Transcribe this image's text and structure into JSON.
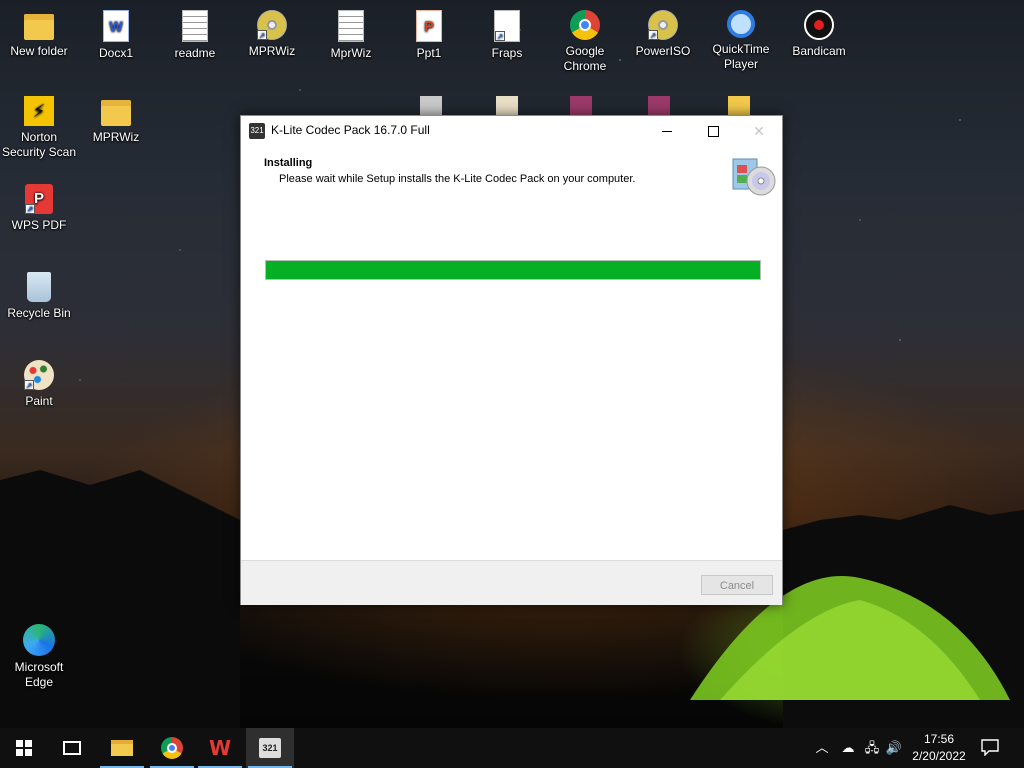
{
  "desktop": {
    "icons": [
      {
        "label": "New folder",
        "icon": "folder-icon"
      },
      {
        "label": "Docx1",
        "icon": "word-doc-icon"
      },
      {
        "label": "readme",
        "icon": "text-file-icon"
      },
      {
        "label": "MPRWiz",
        "icon": "mprwiz-app-icon"
      },
      {
        "label": "MprWiz",
        "icon": "text-file-icon"
      },
      {
        "label": "Ppt1",
        "icon": "ppt-doc-icon"
      },
      {
        "label": "Fraps",
        "icon": "file-icon"
      },
      {
        "label": "Google Chrome",
        "icon": "chrome-icon"
      },
      {
        "label": "PowerISO",
        "icon": "poweriso-icon"
      },
      {
        "label": "QuickTime Player",
        "icon": "quicktime-icon"
      },
      {
        "label": "Bandicam",
        "icon": "bandicam-icon"
      },
      {
        "label": "Norton Security Scan",
        "icon": "norton-icon"
      },
      {
        "label": "MPRWiz",
        "icon": "folder-icon"
      },
      {
        "label": "WPS PDF",
        "icon": "wps-pdf-icon"
      },
      {
        "label": "Recycle Bin",
        "icon": "recycle-bin-icon"
      },
      {
        "label": "Paint",
        "icon": "paint-icon"
      },
      {
        "label": "Microsoft Edge",
        "icon": "edge-icon"
      }
    ]
  },
  "installer": {
    "title": "K-Lite Codec Pack 16.7.0 Full",
    "app_icon_text": "321",
    "header_title": "Installing",
    "header_subtitle": "Please wait while Setup installs the K-Lite Codec Pack on your computer.",
    "progress_percent": 100,
    "progress_color": "#06b025",
    "cancel_label": "Cancel",
    "cancel_enabled": false
  },
  "taskbar": {
    "klite_text": "321",
    "wps_text": "W",
    "time": "17:56",
    "date": "2/20/2022"
  }
}
